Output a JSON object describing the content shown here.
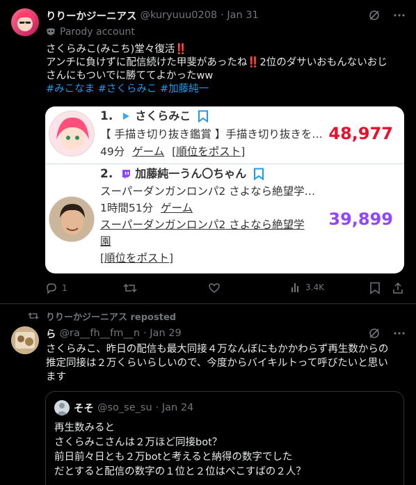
{
  "post1": {
    "author_name": "りりーかジーニアス",
    "author_handle": "@kuryuuu0208",
    "time": "· Jan 31",
    "parody_label": "Parody account",
    "line1": "さくらみこ(みこち)堂々復活",
    "line2a": "アンチに負けずに配信続けた甲斐があったね",
    "line2b": "2位のダサいおもんないおじ",
    "line3": "さんにもついでに勝ててよかったww",
    "bangs": "‼️",
    "hashtags": "#みこなま #さくらみこ #加藤純一",
    "card": {
      "row1": {
        "rank": "1.",
        "name": "さくらみこ",
        "title": "【 手描き切り抜き鑑賞 】手描き切り抜きを…",
        "duration": "49分",
        "category": "ゲーム",
        "post_link": "[順位をポスト]",
        "score": "48,977",
        "score_color": "#e8112d"
      },
      "row2": {
        "rank": "2.",
        "name": "加藤純一うん〇ちゃん",
        "title": "スーパーダンガンロンパ2 さよなら絶望学…",
        "duration": "1時間51分",
        "category": "ゲーム",
        "game_line1": "スーパーダンガンロンパ2 さよなら絶望学",
        "game_line2": "園",
        "post_link": "[順位をポスト]",
        "score": "39,899",
        "score_color": "#9146ff"
      }
    },
    "actions": {
      "replies": "1",
      "retweets": "",
      "likes": "",
      "views": "3.4K"
    }
  },
  "post2": {
    "repost_label": "りりーかジーニアス reposted",
    "author_name": "ら",
    "author_handle": "@ra__fh__fm__n",
    "time": "· Jan 29",
    "line1": "さくらみこ、昨日の配信も最大同接４万なんぼにもかかわらず再生数からの",
    "line2": "推定同接は２万くらいらしいので、今度からバイキルトって呼びたいと思い",
    "line3": "ます",
    "quote": {
      "author_name": "そそ",
      "author_handle": "@so_se_su",
      "time": "· Jan 24",
      "line1": "再生数みると",
      "line2": "さくらみこさんは２万ほど同接bot？",
      "line3": "前日前々日とも２万botと考えると納得の数字でした",
      "line4": "だとすると配信の数字の１位と２位はぺこすばの２人？"
    }
  }
}
